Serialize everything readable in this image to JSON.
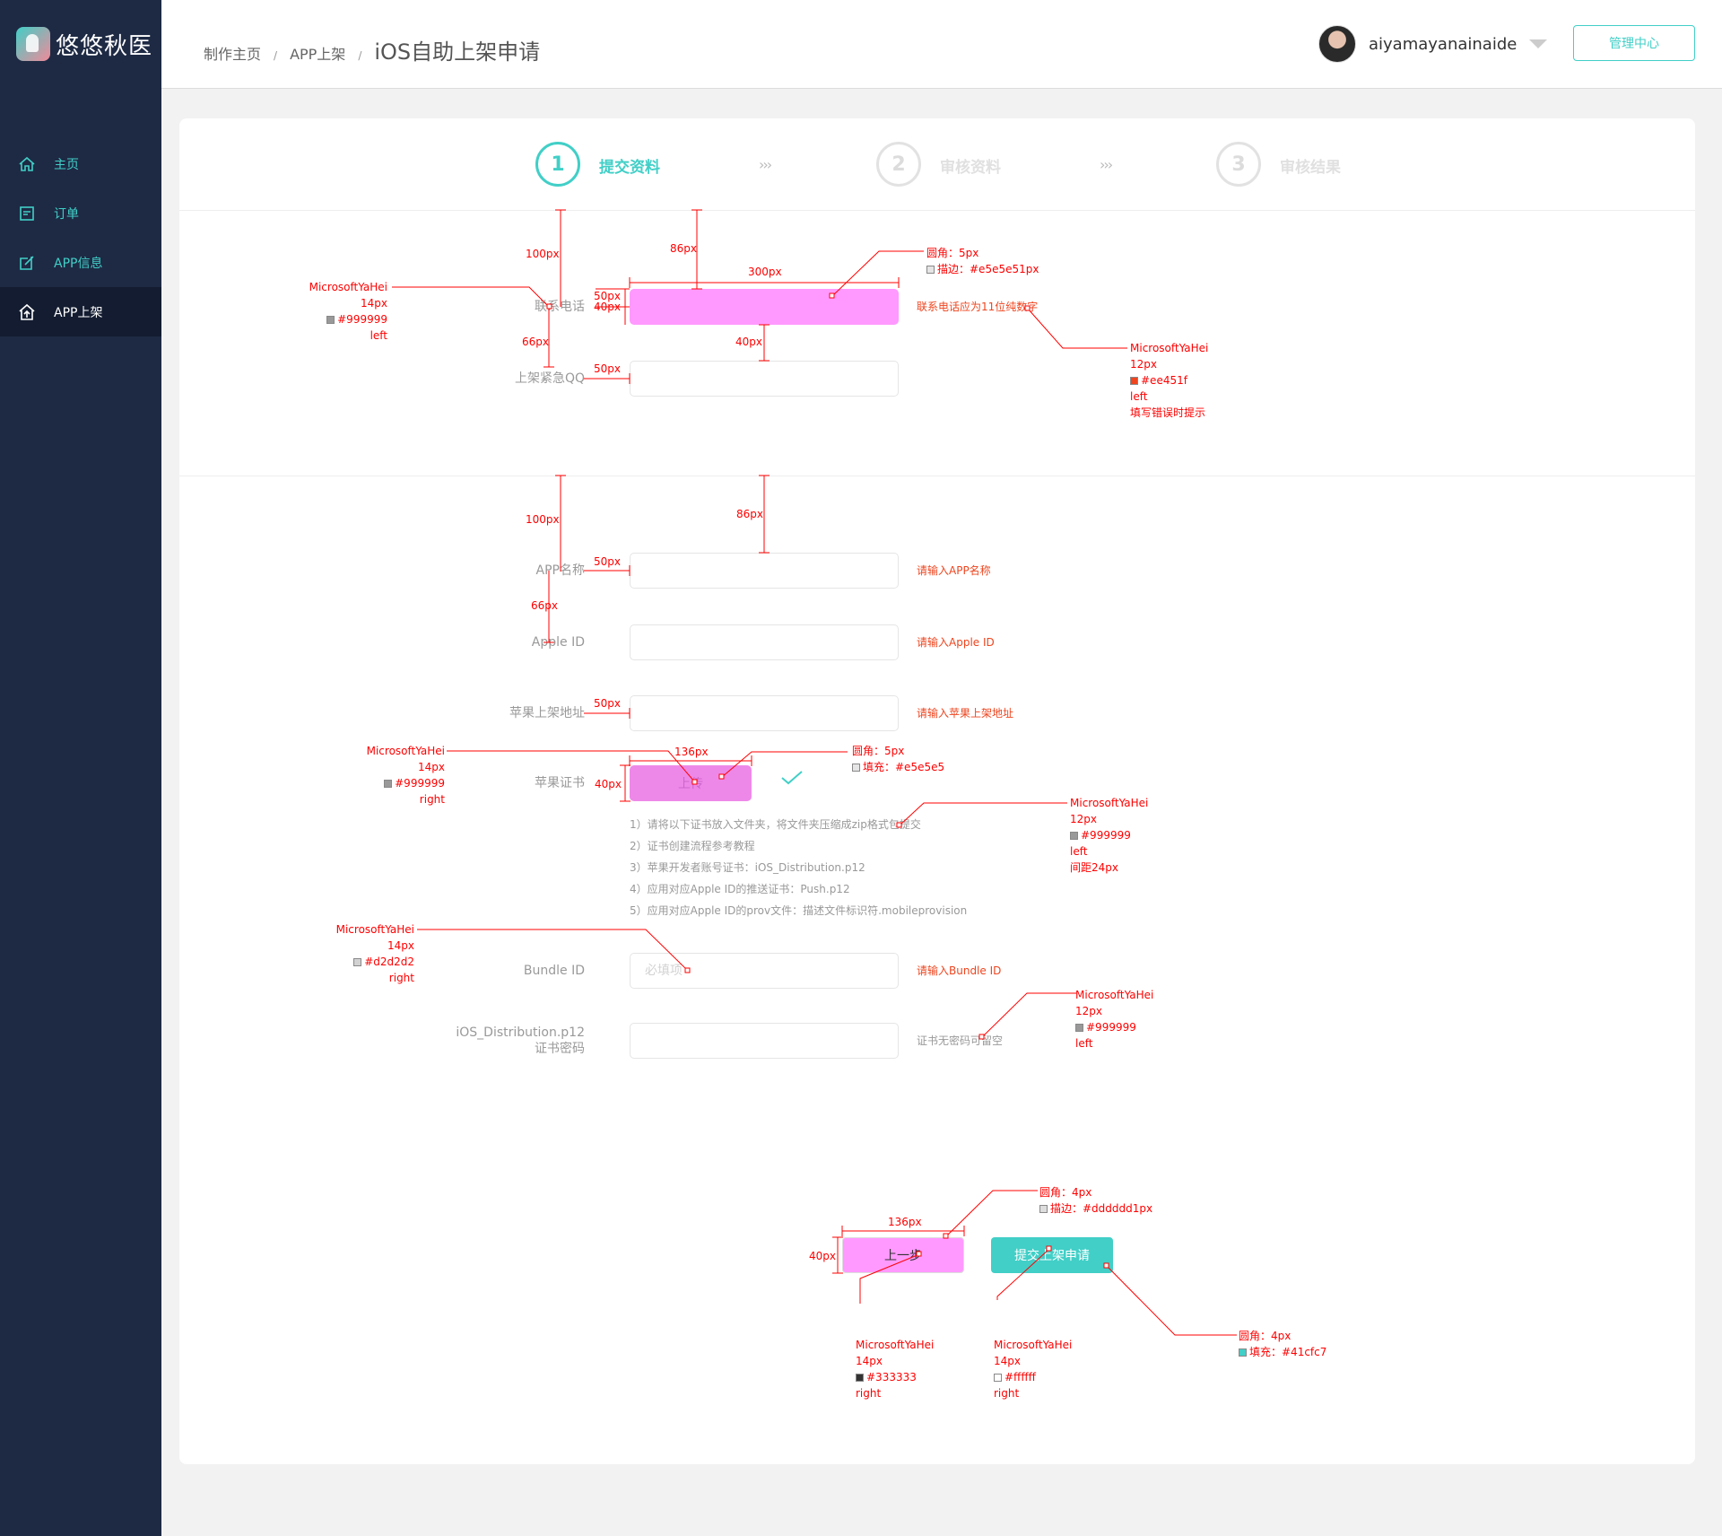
{
  "sidebar": {
    "logo_text": "悠悠秋医",
    "items": [
      {
        "label": "主页",
        "icon": "home-icon"
      },
      {
        "label": "订单",
        "icon": "order-icon"
      },
      {
        "label": "APP信息",
        "icon": "edit-icon"
      },
      {
        "label": "APP上架",
        "icon": "upload-icon",
        "active": true
      }
    ]
  },
  "header": {
    "breadcrumb": [
      "制作主页",
      "APP上架"
    ],
    "separator": "/",
    "current": "iOS自助上架申请",
    "username": "aiyamayanainaide",
    "admin_button": "管理中心"
  },
  "steps": [
    {
      "num": "1",
      "label": "提交资料",
      "active": true
    },
    {
      "num": "2",
      "label": "审核资料",
      "active": false
    },
    {
      "num": "3",
      "label": "审核结果",
      "active": false
    }
  ],
  "step_arrow": "›››",
  "section1": {
    "fields": [
      {
        "label": "联系电话",
        "value": "",
        "hint": "联系电话应为11位纯数字"
      },
      {
        "label": "上架紧急QQ",
        "value": "",
        "hint": ""
      }
    ]
  },
  "section2": {
    "fields": [
      {
        "label": "APP名称",
        "hint": "请输入APP名称"
      },
      {
        "label": "Apple ID",
        "hint": "请输入Apple ID"
      },
      {
        "label": "苹果上架地址",
        "hint": "请输入苹果上架地址"
      }
    ],
    "cert_label": "苹果证书",
    "upload_label": "上传",
    "instructions": [
      "1）请将以下证书放入文件夹，将文件夹压缩成zip格式包提交",
      "2）证书创建流程参考教程",
      "3）苹果开发者账号证书：iOS_Distribution.p12",
      "4）应用对应Apple ID的推送证书：Push.p12",
      "5）应用对应Apple ID的prov文件：描述文件标识符.mobileprovision"
    ],
    "bundle_label": "Bundle ID",
    "bundle_placeholder": "必填项",
    "bundle_hint": "请输入Bundle ID",
    "pwd_label_1": "iOS_Distribution.p12",
    "pwd_label_2": "证书密码",
    "pwd_hint": "证书无密码可留空"
  },
  "buttons": {
    "prev": "上一步",
    "submit": "提交上架申请"
  },
  "colors": {
    "accent": "#41cfc7",
    "sidebar": "#1e2a44",
    "error": "#ee451f",
    "annotation": "#ff0000",
    "highlight": "#ff99ff"
  },
  "annotations": {
    "dims": {
      "d100a": "100px",
      "d86a": "86px",
      "d300": "300px",
      "d50a": "50px",
      "d40a": "40px",
      "d66a": "66px",
      "d40b": "40px",
      "d50b": "50px",
      "d100b": "100px",
      "d86b": "86px",
      "d50c": "50px",
      "d66b": "66px",
      "d50d": "50px",
      "d136a": "136px",
      "d40c": "40px",
      "d136b": "136px",
      "d40d": "40px"
    },
    "font_label_left": [
      "MicrosoftYaHei",
      "14px",
      "#999999",
      "left"
    ],
    "input_style": [
      "圆角：5px",
      "描边：#e5e5e51px"
    ],
    "error_style": [
      "MicrosoftYaHei",
      "12px",
      "#ee451f",
      "left",
      "填写错误时提示"
    ],
    "cert_label_style": [
      "MicrosoftYaHei",
      "14px",
      "#999999",
      "right"
    ],
    "upload_style": [
      "圆角：5px",
      "填充：#e5e5e5"
    ],
    "instr_style": [
      "MicrosoftYaHei",
      "12px",
      "#999999",
      "left",
      "间距24px"
    ],
    "placeholder_style": [
      "MicrosoftYaHei",
      "14px",
      "#d2d2d2",
      "right"
    ],
    "pwd_hint_style": [
      "MicrosoftYaHei",
      "12px",
      "#999999",
      "left"
    ],
    "prev_btn_style": [
      "圆角：4px",
      "描边：#dddddd1px"
    ],
    "prev_text_style": [
      "MicrosoftYaHei",
      "14px",
      "#333333",
      "right"
    ],
    "submit_text_style": [
      "MicrosoftYaHei",
      "14px",
      "#ffffff",
      "right"
    ],
    "submit_btn_style": [
      "圆角：4px",
      "填充：#41cfc7"
    ]
  }
}
